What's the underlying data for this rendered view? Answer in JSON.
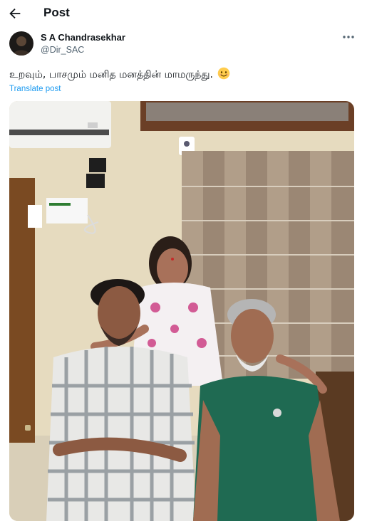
{
  "header": {
    "title": "Post",
    "back_icon": "arrow-left-icon"
  },
  "author": {
    "name": "S A Chandrasekhar",
    "handle": "@Dir_SAC"
  },
  "tweet": {
    "text": "உறவும், பாசமும் மனித மனத்தின் மாமருந்து.",
    "emoji": "smiling-face-icon",
    "translate_label": "Translate post"
  },
  "colors": {
    "link": "#1d9bf0",
    "secondary_text": "#536471",
    "text": "#0f1419"
  }
}
